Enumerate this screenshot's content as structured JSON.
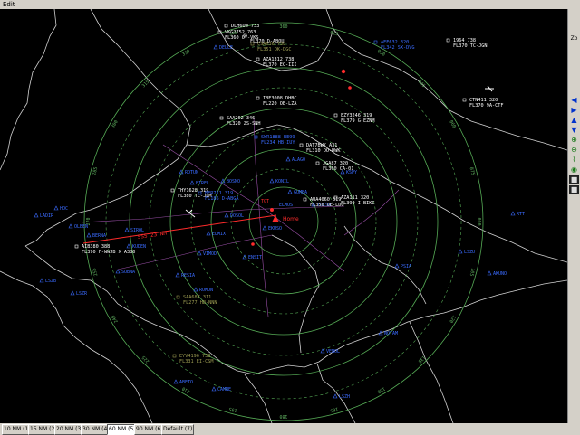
{
  "menu": {
    "items": [
      "Edit"
    ]
  },
  "range_tabs": [
    {
      "label": "10 NM (1)",
      "active": false
    },
    {
      "label": "15 NM (2)",
      "active": false
    },
    {
      "label": "20 NM (3)",
      "active": false
    },
    {
      "label": "30 NM (4)",
      "active": false
    },
    {
      "label": "60 NM (5)",
      "active": true
    },
    {
      "label": "90 NM (6)",
      "active": false
    },
    {
      "label": "Default (7)",
      "active": false
    }
  ],
  "toolbar": {
    "zoom_label": "Zo",
    "buttons": [
      "arrow-left-icon",
      "arrow-right-icon",
      "arrow-up-icon",
      "arrow-down-icon",
      "zoom-in-icon",
      "zoom-out-icon",
      "measure-icon",
      "color-icon",
      "square-icon",
      "square-icon"
    ]
  },
  "colors": {
    "background": "#000000",
    "ring": "#55aa55",
    "tag_white": "#ffffff",
    "tag_blue": "#3a6bff",
    "tag_olive": "#9a9a50",
    "border_line": "#d0d0d0",
    "vector_line": "#ff2b2b"
  },
  "bearings": [
    "315",
    "330",
    "345",
    "360",
    "015",
    "030",
    "045",
    "060",
    "075",
    "090",
    "105",
    "120",
    "135",
    "150",
    "165",
    "180",
    "195",
    "210",
    "225",
    "240",
    "255",
    "270",
    "285",
    "300"
  ],
  "aircraft": [
    {
      "line1": "DLH6UW 733",
      "line2": "",
      "color": "white"
    },
    {
      "line1": "VKG2752 763",
      "line2": "FL360 OY-VKS",
      "color": "white"
    },
    {
      "line1": "",
      "line2": "FL370 D-ABOU",
      "color": "white"
    },
    {
      "line1": "CSA636 738",
      "line2": "FL351 OK-DGC",
      "color": "olive"
    },
    {
      "line1": "AZA1312 738",
      "line2": "FL370 EC-III",
      "color": "white"
    },
    {
      "line1": "AEE632 320",
      "line2": "FL342 SX-DVG",
      "color": "blue"
    },
    {
      "line1": "1964 738",
      "line2": "FL370 TC-JGN",
      "color": "white"
    },
    {
      "line1": "CTN411 320",
      "line2": "FL370 9A-CTF",
      "color": "white"
    },
    {
      "line1": "IBE3008 DHBC",
      "line2": "FL220 OE-LZA",
      "color": "white"
    },
    {
      "line1": "SAA262 346",
      "line2": "FL320 ZS-SNH",
      "color": "white"
    },
    {
      "line1": "EZY3246 319",
      "line2": "FL379 G-EZNM",
      "color": "white"
    },
    {
      "line1": "SWR1888 BE99",
      "line2": "FL234 HB-IUY",
      "color": "blue"
    },
    {
      "line1": "DAT7BWK A31",
      "line2": "FL310 OO-DWK",
      "color": "white"
    },
    {
      "line1": "JGA87 320",
      "line2": "FL360 CA-01",
      "color": "white"
    },
    {
      "line1": "THY1628 319",
      "line2": "FL380 TC-JLM",
      "color": "white"
    },
    {
      "line1": "BER711 319",
      "line2": "FL186 D-ABGA",
      "color": "blue"
    },
    {
      "line1": "AUA4060 319",
      "line2": "FL350 OE-LDO",
      "color": "white"
    },
    {
      "line1": "AZA111 320",
      "line2": "FL390 I-BIKC",
      "color": "white"
    },
    {
      "line1": "AIB380 388",
      "line2": "FL390 F-WWJB X A380",
      "color": "white"
    },
    {
      "line1": "SAA687 311",
      "line2": "FL277 HB-NNN",
      "color": "olive"
    },
    {
      "line1": "EYV4196 738",
      "line2": "FL331 EI-CSM",
      "color": "olive"
    }
  ],
  "waypoints": [
    "DELLE",
    "HOC",
    "LADIR",
    "SIROL",
    "OLBEN",
    "LSZB",
    "BERNA",
    "SUBNA",
    "KUDEN",
    "RESIA",
    "ROMON",
    "CAMNE",
    "BIREL",
    "BOSNO",
    "DOSOL",
    "EKUSO",
    "KONIL",
    "VIMOD",
    "ENSIT",
    "ELMIX",
    "ROTUN",
    "LSZH",
    "PSIA",
    "NOTAM",
    "KSPY",
    "RTT",
    "LSZR",
    "LSZU",
    "ALAGO",
    "VENOL",
    "ABETO",
    "AKUNO",
    "GUMBA",
    "TOLSO"
  ],
  "markers": {
    "home": "Home",
    "target": "TGT",
    "vector_label": "SSS 23 NM",
    "nav_target": "ELMOS"
  }
}
